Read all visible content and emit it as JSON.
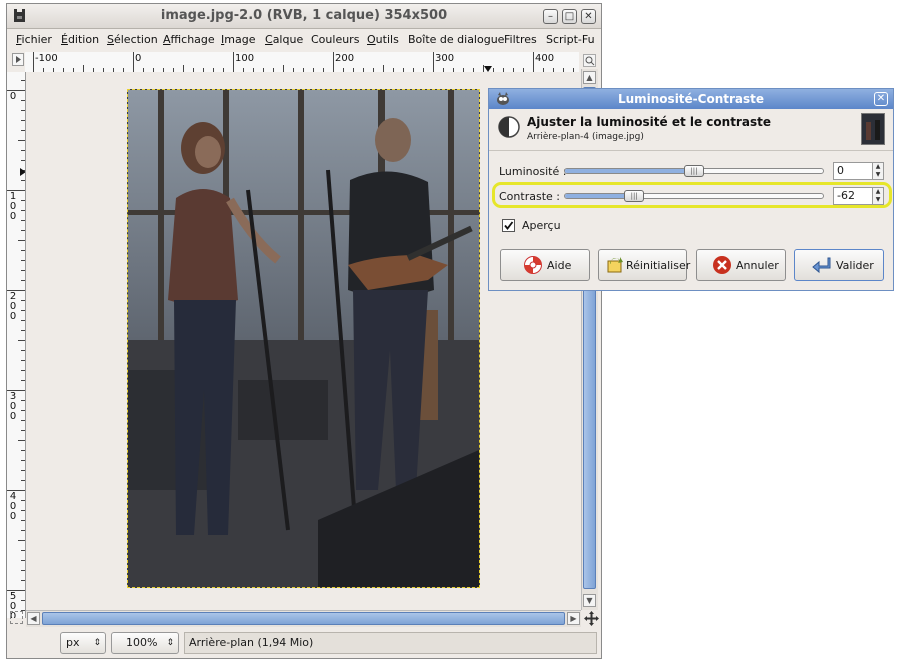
{
  "main_window": {
    "title": "image.jpg-2.0 (RVB, 1 calque) 354x500",
    "menu": [
      {
        "label": "Fichier",
        "u": "F"
      },
      {
        "label": "Édition",
        "u": "É"
      },
      {
        "label": "Sélection",
        "u": "S"
      },
      {
        "label": "Affichage",
        "u": "A"
      },
      {
        "label": "Image",
        "u": "I"
      },
      {
        "label": "Calque",
        "u": "C"
      },
      {
        "label": "Couleurs",
        "u": ""
      },
      {
        "label": "Outils",
        "u": "O"
      },
      {
        "label": "Boîte de dialogue",
        "u": ""
      },
      {
        "label": "Filtres",
        "u": ""
      },
      {
        "label": "Script-Fu",
        "u": ""
      }
    ],
    "hruler_labels": [
      "-100",
      "0",
      "100",
      "200",
      "300",
      "400"
    ],
    "vruler_labels": [
      "0",
      "100",
      "200",
      "300",
      "400",
      "500"
    ],
    "status": {
      "unit": "px",
      "zoom": "100%",
      "info": "Arrière-plan (1,94 Mio)"
    }
  },
  "dialog": {
    "title": "Luminosité-Contraste",
    "heading": "Ajuster la luminosité et le contraste",
    "subheading": "Arrière-plan-4 (image.jpg)",
    "brightness": {
      "label": "Luminosité :",
      "value": "0",
      "level": 0.5
    },
    "contrast": {
      "label": "Contraste :",
      "value": "-62",
      "level": 0.27
    },
    "preview": {
      "label": "Aperçu",
      "checked": true
    },
    "buttons": {
      "help": "Aide",
      "reset": "Réinitialiser",
      "cancel": "Annuler",
      "ok": "Valider"
    }
  },
  "colors": {
    "highlight": "#e6e62a",
    "accent": "#5c86c9"
  }
}
